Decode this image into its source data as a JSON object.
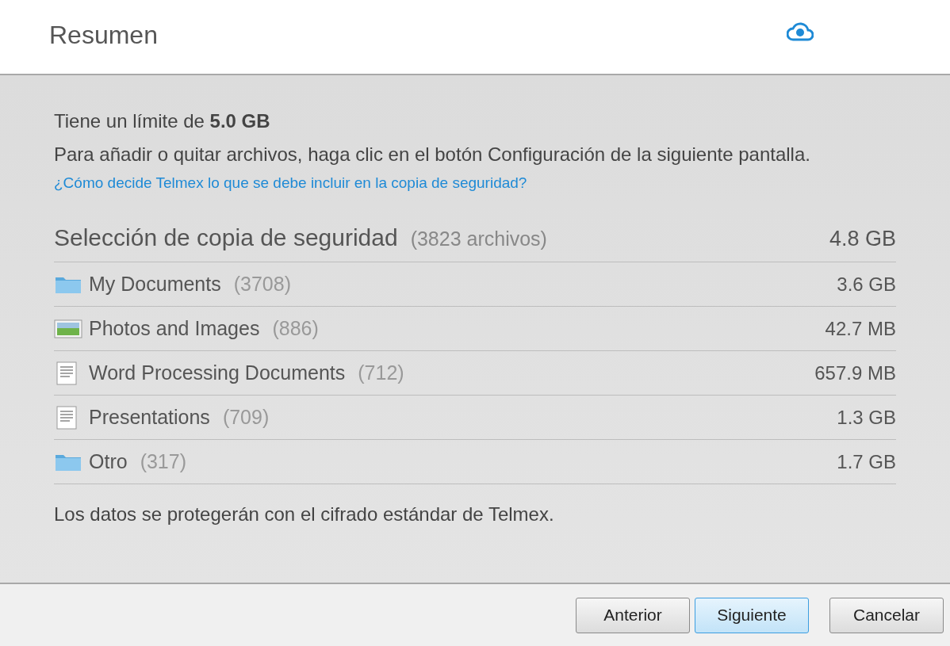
{
  "header": {
    "title": "Resumen"
  },
  "intro": {
    "limit": "Tiene un límite de **5.0 GB**",
    "instructions": "Para añadir o quitar archivos, haga clic en el botón Configuración de la siguiente pantalla.",
    "help_link": "¿Cómo decide Telmex lo que se debe incluir en la copia de seguridad?"
  },
  "selection": {
    "title": "Selección de copia de seguridad",
    "count": "(3823 archivos)",
    "size": "4.8 GB"
  },
  "categories": [
    {
      "kind": "folder",
      "name": "My Documents",
      "count": "(3708)",
      "size": "3.6 GB"
    },
    {
      "kind": "photo",
      "name": "Photos and Images",
      "count": "(886)",
      "size": "42.7 MB"
    },
    {
      "kind": "document",
      "name": "Word Processing Documents",
      "count": "(712)",
      "size": "657.9 MB"
    },
    {
      "kind": "document",
      "name": "Presentations",
      "count": "(709)",
      "size": "1.3 GB"
    },
    {
      "kind": "folder",
      "name": "Otro",
      "count": "(317)",
      "size": "1.7 GB"
    }
  ],
  "encryption_note": "Los datos se protegerán con el cifrado estándar de Telmex.",
  "buttons": [
    {
      "label": "Anterior",
      "selected": false
    },
    {
      "label": "Siguiente",
      "selected": true
    },
    {
      "label": "Cancelar",
      "selected": false
    }
  ]
}
